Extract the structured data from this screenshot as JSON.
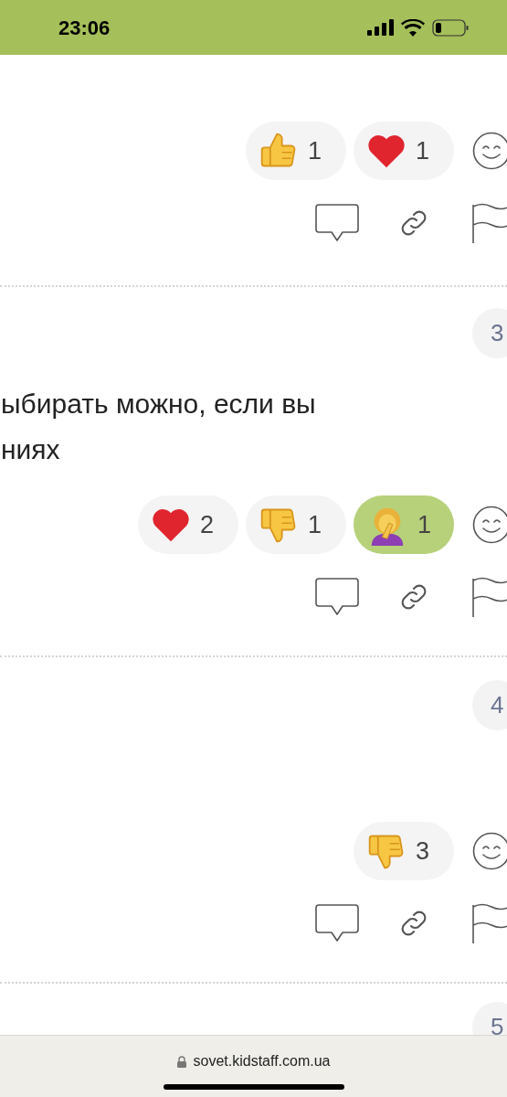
{
  "status_bar": {
    "time": "23:06"
  },
  "posts": [
    {
      "reactions": [
        {
          "kind": "thumbs-up",
          "count": "1",
          "selected": false
        },
        {
          "kind": "heart",
          "count": "1",
          "selected": false
        }
      ]
    },
    {
      "number": "3",
      "text_lines": [
        "ыбирать можно, если вы",
        "ниях"
      ],
      "reactions": [
        {
          "kind": "heart",
          "count": "2",
          "selected": false
        },
        {
          "kind": "thumbs-down",
          "count": "1",
          "selected": false
        },
        {
          "kind": "facepalm",
          "count": "1",
          "selected": true
        }
      ]
    },
    {
      "number": "4",
      "reactions": [
        {
          "kind": "thumbs-down",
          "count": "3",
          "selected": false
        }
      ]
    },
    {
      "number": "5"
    }
  ],
  "address_bar": {
    "url": "sovet.kidstaff.com.ua"
  }
}
